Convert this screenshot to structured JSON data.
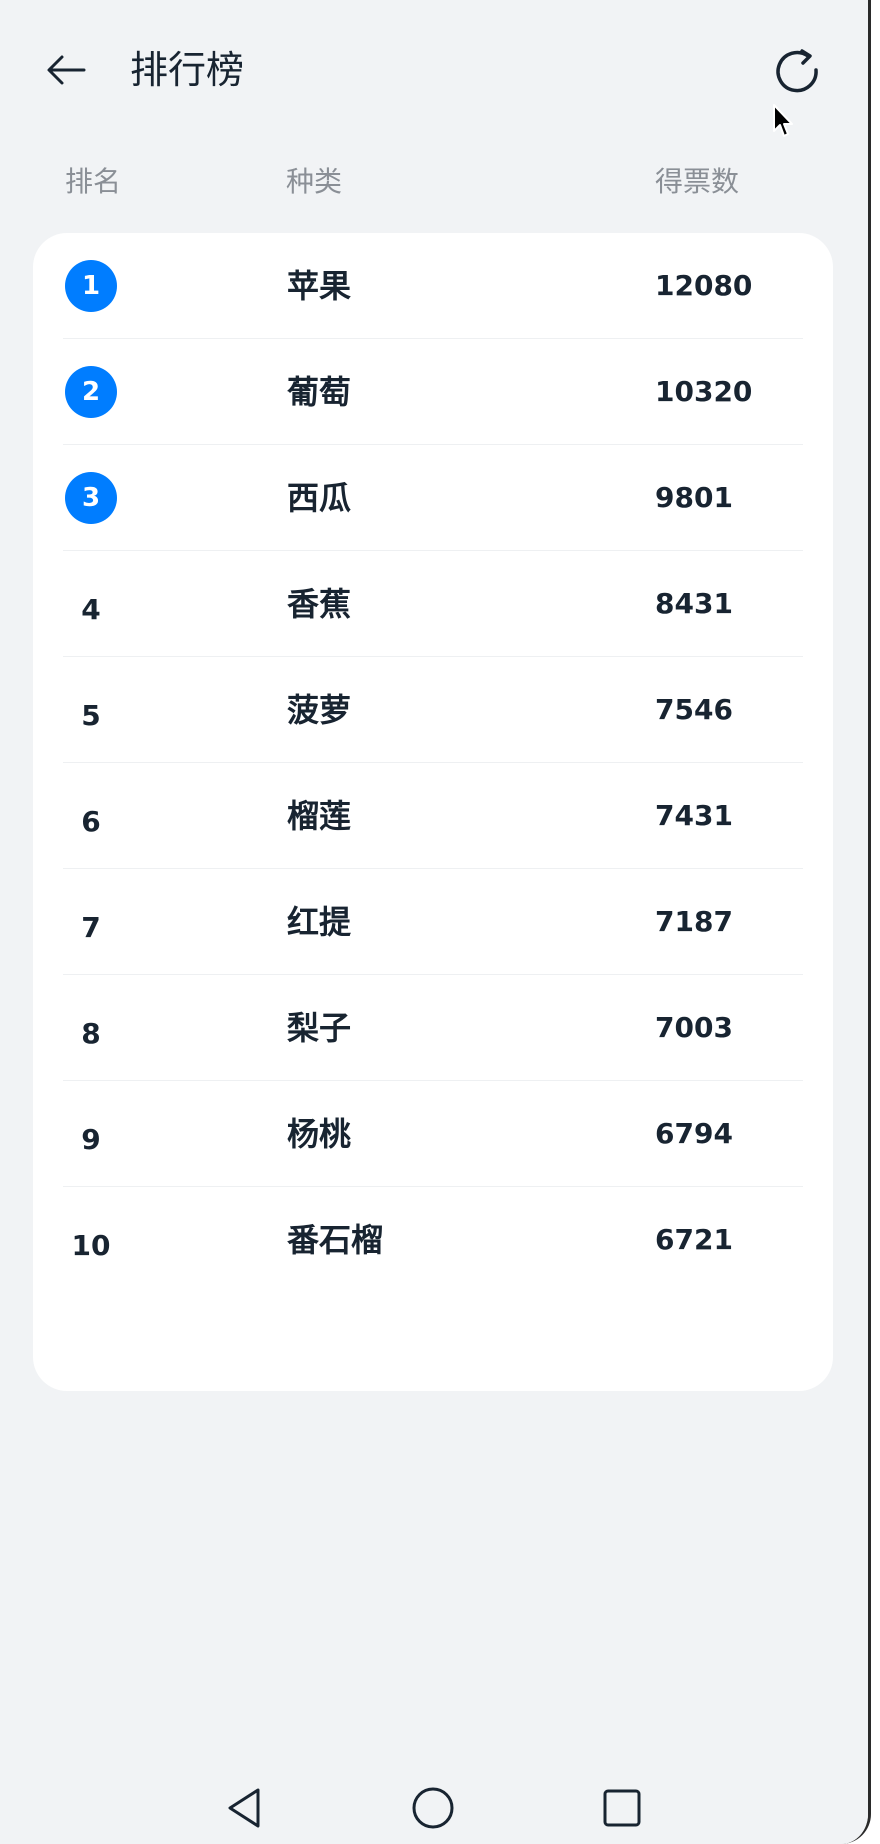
{
  "header": {
    "title": "排行榜",
    "back_icon": "arrow-left-icon",
    "refresh_icon": "refresh-icon"
  },
  "columns": {
    "rank": "排名",
    "type": "种类",
    "votes": "得票数"
  },
  "rows": [
    {
      "rank": "1",
      "name": "苹果",
      "votes": "12080",
      "highlight": true
    },
    {
      "rank": "2",
      "name": "葡萄",
      "votes": "10320",
      "highlight": true
    },
    {
      "rank": "3",
      "name": "西瓜",
      "votes": "9801",
      "highlight": true
    },
    {
      "rank": "4",
      "name": "香蕉",
      "votes": "8431",
      "highlight": false
    },
    {
      "rank": "5",
      "name": "菠萝",
      "votes": "7546",
      "highlight": false
    },
    {
      "rank": "6",
      "name": "榴莲",
      "votes": "7431",
      "highlight": false
    },
    {
      "rank": "7",
      "name": "红提",
      "votes": "7187",
      "highlight": false
    },
    {
      "rank": "8",
      "name": "梨子",
      "votes": "7003",
      "highlight": false
    },
    {
      "rank": "9",
      "name": "杨桃",
      "votes": "6794",
      "highlight": false
    },
    {
      "rank": "10",
      "name": "番石榴",
      "votes": "6721",
      "highlight": false
    }
  ],
  "colors": {
    "accent": "#007dff",
    "background": "#f1f3f5",
    "card": "#ffffff",
    "text": "#182431",
    "muted": "#8a8f96"
  },
  "navbar": {
    "back_icon": "triangle-back-icon",
    "home_icon": "circle-home-icon",
    "recents_icon": "square-recents-icon"
  }
}
